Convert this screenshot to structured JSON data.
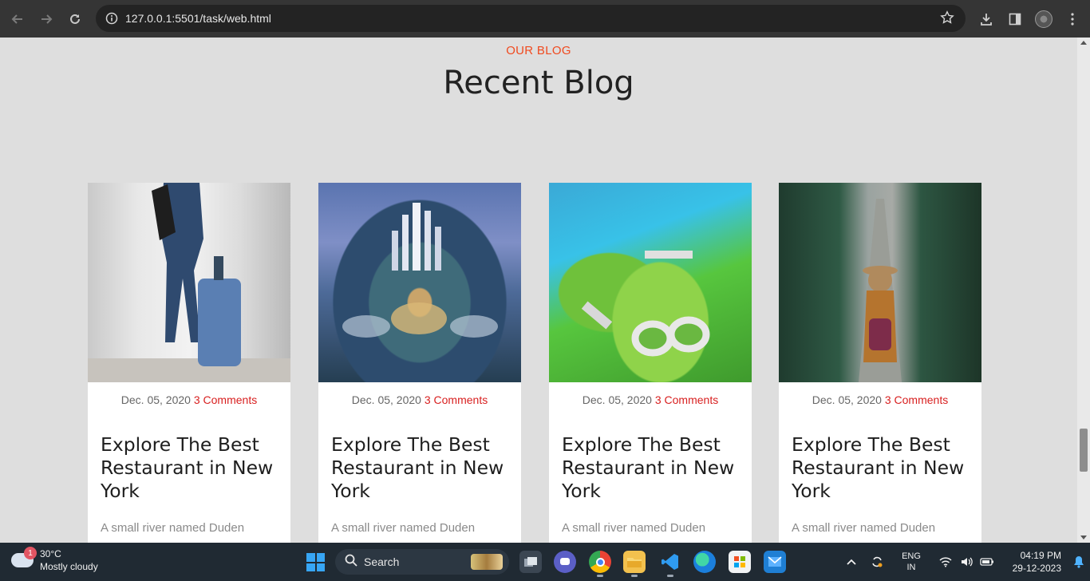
{
  "browser": {
    "url": "127.0.0.1:5501/task/web.html"
  },
  "page": {
    "eyebrow": "OUR BLOG",
    "heading": "Recent Blog",
    "cards": [
      {
        "date": "Dec. 05, 2020",
        "comments": "3 Comments",
        "title": "Explore The Best Restaurant in New York",
        "excerpt": "A small river named Duden",
        "image": "traveler-with-suitcase"
      },
      {
        "date": "Dec. 05, 2020",
        "comments": "3 Comments",
        "title": "Explore The Best Restaurant in New York",
        "excerpt": "A small river named Duden",
        "image": "futuristic-city"
      },
      {
        "date": "Dec. 05, 2020",
        "comments": "3 Comments",
        "title": "Explore The Best Restaurant in New York",
        "excerpt": "A small river named Duden",
        "image": "aerial-island-resort"
      },
      {
        "date": "Dec. 05, 2020",
        "comments": "3 Comments",
        "title": "Explore The Best Restaurant in New York",
        "excerpt": "A small river named Duden",
        "image": "woman-on-forest-road"
      }
    ],
    "accent_color": "#f04a1f",
    "comments_color": "#d81f1f"
  },
  "taskbar": {
    "weather_temp": "30°C",
    "weather_desc": "Mostly cloudy",
    "weather_badge": "1",
    "search_label": "Search",
    "lang_line1": "ENG",
    "lang_line2": "IN",
    "time": "04:19 PM",
    "date": "29-12-2023"
  }
}
